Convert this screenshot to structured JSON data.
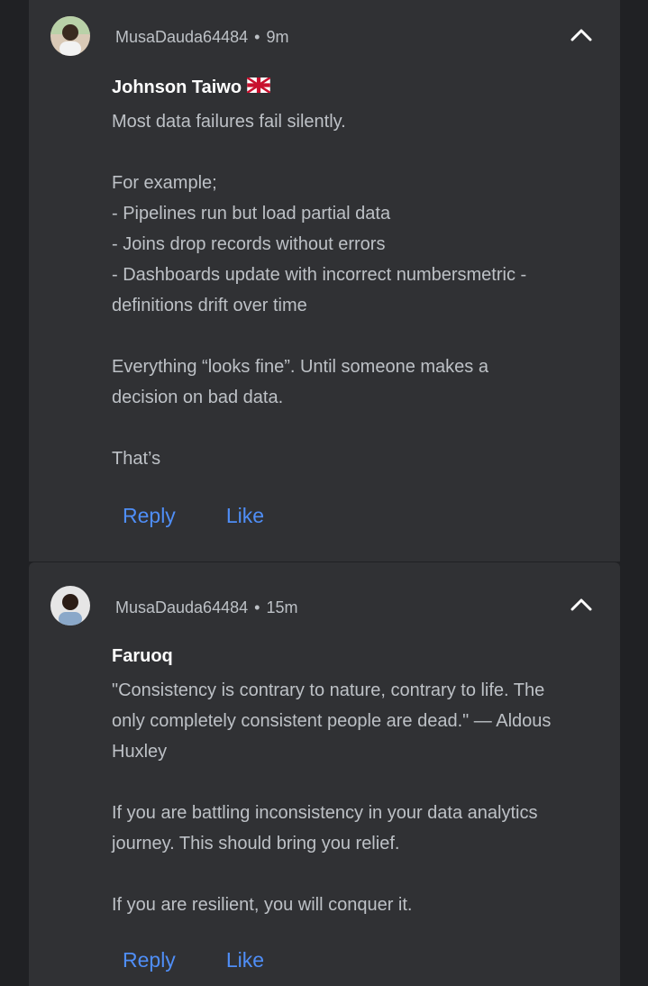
{
  "comments": [
    {
      "username": "MusaDauda64484",
      "separator": "•",
      "time": "9m",
      "author": "Johnson Taiwo",
      "author_flag": "uk-flag",
      "paragraphs": [
        [
          "Most data failures fail silently."
        ],
        [
          "For example;",
          "- Pipelines run but load partial data",
          "- Joins drop records without errors",
          "- Dashboards update with incorrect numbersmetric -",
          "definitions drift over time"
        ],
        [
          "Everything “looks fine”. Until someone makes a",
          "decision on bad data."
        ],
        [
          "That’s"
        ]
      ],
      "reply_label": "Reply",
      "like_label": "Like",
      "icons": {
        "avatar": "user-avatar-icon",
        "collapse": "chevron-up-icon"
      }
    },
    {
      "username": "MusaDauda64484",
      "separator": "•",
      "time": "15m",
      "author": "Faruoq",
      "paragraphs": [
        [
          "\"Consistency is contrary to nature, contrary to life. The",
          "only completely consistent people are dead.\" — Aldous",
          "Huxley"
        ],
        [
          "If you are battling inconsistency in your data analytics",
          "journey. This should bring you relief."
        ],
        [
          "If you are resilient, you will conquer it."
        ]
      ],
      "reply_label": "Reply",
      "like_label": "Like",
      "icons": {
        "avatar": "user-avatar-icon",
        "collapse": "chevron-up-icon"
      }
    }
  ],
  "colors": {
    "page_background": "#202124",
    "card_background": "#303134",
    "action_link": "#4f8ef7",
    "body_text": "#bdc1c6",
    "author_text": "#ffffff"
  }
}
